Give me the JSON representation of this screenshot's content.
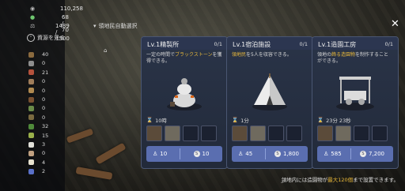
{
  "hud": {
    "silver": "110,258",
    "energy": "68 / 70",
    "weight": "1489 / 1500",
    "view_resources_label": "資源を見る",
    "resources": [
      {
        "icon": "wood-icon",
        "count": "40",
        "color": "#8b6a3e"
      },
      {
        "icon": "stone-icon",
        "count": "0",
        "color": "#8e8e8e"
      },
      {
        "icon": "meat-icon",
        "count": "21",
        "color": "#b5523c"
      },
      {
        "icon": "leather-icon",
        "count": "0",
        "color": "#a07d5a"
      },
      {
        "icon": "ore-icon",
        "count": "0",
        "color": "#b08a50"
      },
      {
        "icon": "log-icon",
        "count": "0",
        "color": "#7a5030"
      },
      {
        "icon": "herb-icon",
        "count": "0",
        "color": "#6a8a48"
      },
      {
        "icon": "branch-icon",
        "count": "0",
        "color": "#7a6a40"
      },
      {
        "icon": "plant-icon",
        "count": "32",
        "color": "#4f8a3a"
      },
      {
        "icon": "flower-icon",
        "count": "15",
        "color": "#9ab04a"
      },
      {
        "icon": "cotton-icon",
        "count": "3",
        "color": "#e0e0d8"
      },
      {
        "icon": "shell-icon",
        "count": "0",
        "color": "#c0a080"
      },
      {
        "icon": "egg-icon",
        "count": "4",
        "color": "#e8e2d0"
      },
      {
        "icon": "gem-icon",
        "count": "2",
        "color": "#5a70c8"
      }
    ]
  },
  "overlay": {
    "title": "領地民自動選択",
    "close_label": "✕"
  },
  "cards": [
    {
      "title": "Lv.1精製所",
      "count": "0/1",
      "desc_pre": "一定の時間で",
      "desc_hl": "ブラックストーン",
      "desc_post": "を獲得できる。",
      "time": "10時",
      "workers": "10",
      "cost": "10"
    },
    {
      "title": "Lv.1宿泊施設",
      "count": "0/1",
      "desc_pre": "",
      "desc_hl": "領地民",
      "desc_post": "を5人を収容できる。",
      "time": "1分",
      "workers": "45",
      "cost": "1,800"
    },
    {
      "title": "Lv.1造園工房",
      "count": "0/1",
      "desc_pre": "領地の",
      "desc_hl": "飾る造園物",
      "desc_post": "を制作することができる。",
      "time": "23分 23秒",
      "workers": "585",
      "cost": "7,200"
    }
  ],
  "footer": {
    "pre": "領地内には造園物が",
    "hl": "最大120個",
    "post": "まで設置できます。"
  },
  "colors": {
    "highlight": "#e8b83a",
    "cost_bar": "#5a6eb0",
    "card_bg": "#222a3a"
  }
}
